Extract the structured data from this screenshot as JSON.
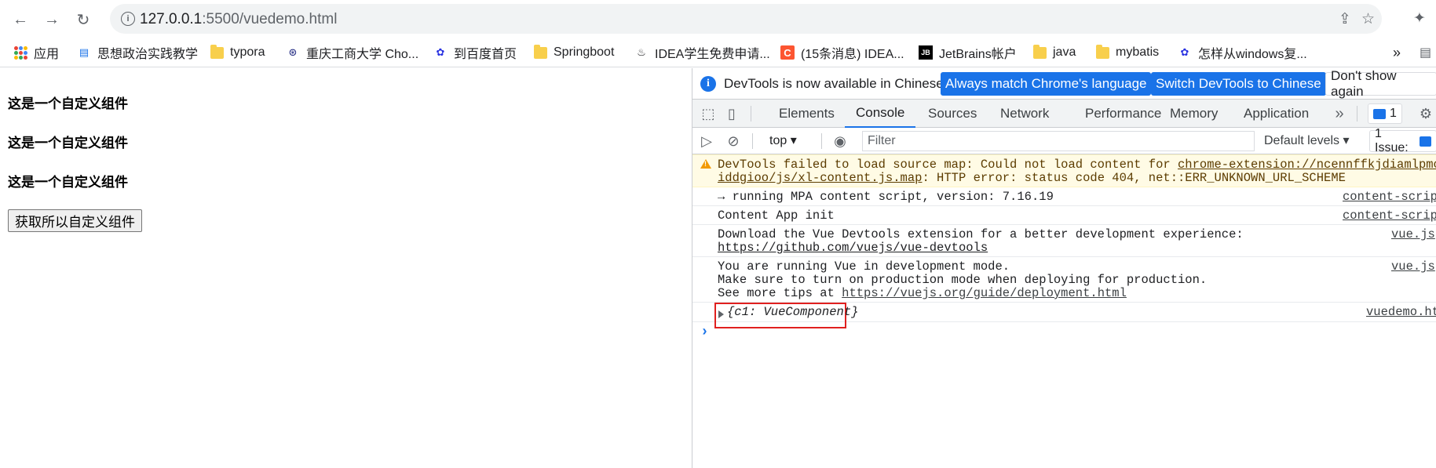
{
  "browser": {
    "url_host": "127.0.0.1",
    "url_rest": ":5500/vuedemo.html"
  },
  "bookmarks": [
    {
      "label": "应用"
    },
    {
      "label": "思想政治实践教学"
    },
    {
      "label": "typora"
    },
    {
      "label": "重庆工商大学 Cho..."
    },
    {
      "label": "到百度首页"
    },
    {
      "label": "Springboot"
    },
    {
      "label": "IDEA学生免费申请..."
    },
    {
      "label": "(15条消息) IDEA..."
    },
    {
      "label": "JetBrains帐户"
    },
    {
      "label": "java"
    },
    {
      "label": "mybatis"
    },
    {
      "label": "怎样从windows复..."
    }
  ],
  "page": {
    "components": [
      "这是一个自定义组件",
      "这是一个自定义组件",
      "这是一个自定义组件"
    ],
    "button_label": "获取所以自定义组件"
  },
  "devtools": {
    "info_text": "DevTools is now available in Chinese!",
    "btn_match": "Always match Chrome's language",
    "btn_switch": "Switch DevTools to Chinese",
    "btn_dismiss": "Don't show again",
    "tabs": [
      "Elements",
      "Console",
      "Sources",
      "Network",
      "Performance",
      "Memory",
      "Application"
    ],
    "issues_badge": "1",
    "context": "top",
    "filter_placeholder": "Filter",
    "levels": "Default levels",
    "issues_count": "1 Issue:",
    "console": {
      "warn_line1": "DevTools failed to load source map: Could not load content for ",
      "warn_link1": "chrome-extension://ncennffkjdiamlpmcba",
      "warn_link2": "iddgioo/js/xl-content.js.map",
      "warn_line2_rest": ": HTTP error: status code 404, net::ERR_UNKNOWN_URL_SCHEME",
      "row1_text": "→ running MPA content script, version: 7.16.19",
      "row1_src": "content-script",
      "row2_text": "Content App init",
      "row2_src": "content-script",
      "row3_text": "Download the Vue Devtools extension for a better development experience:",
      "row3_link": "https://github.com/vuejs/vue-devtools",
      "row3_src": "vue.js",
      "row4_line1": "You are running Vue in development mode.",
      "row4_line2": "Make sure to turn on production mode when deploying for production.",
      "row4_line3_prefix": "See more tips at ",
      "row4_link": "https://vuejs.org/guide/deployment.html",
      "row4_src": "vue.js",
      "row5_text": "{c1: VueComponent}",
      "row5_src": "vuedemo.ht",
      "prompt": "›"
    }
  }
}
